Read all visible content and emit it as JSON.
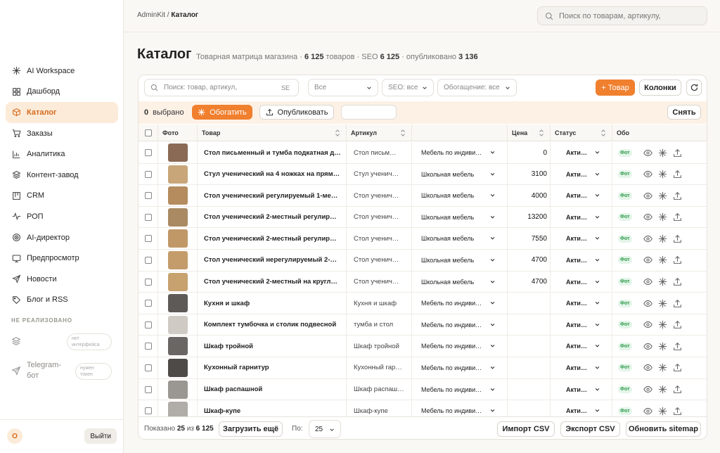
{
  "breadcrumb": {
    "root": "AdminKit",
    "sep": "/",
    "current": "Каталог"
  },
  "top_search": {
    "placeholder": "Поиск по товарам, артикулу,"
  },
  "page": {
    "title": "Каталог",
    "subtitle_prefix": "Товарная матрица магазина · ",
    "goods_count": "6 125",
    "goods_word": " товаров · SEO ",
    "seo_count": "6 125",
    "published_word": " · опубликовано ",
    "published_count": "3 136"
  },
  "sidebar": {
    "items": [
      {
        "label": "AI Workspace",
        "icon": "sparkle-icon"
      },
      {
        "label": "Дашборд",
        "icon": "grid-icon"
      },
      {
        "label": "Каталог",
        "icon": "box-icon"
      },
      {
        "label": "Заказы",
        "icon": "cart-icon"
      },
      {
        "label": "Аналитика",
        "icon": "chart-icon"
      },
      {
        "label": "Контент-завод",
        "icon": "layers-icon"
      },
      {
        "label": "CRM",
        "icon": "kanban-icon"
      },
      {
        "label": "РОП",
        "icon": "pulse-icon"
      },
      {
        "label": "AI-директор",
        "icon": "target-icon"
      },
      {
        "label": "Предпросмотр",
        "icon": "monitor-icon"
      },
      {
        "label": "Новости",
        "icon": "send-icon"
      },
      {
        "label": "Блог и RSS",
        "icon": "tag-icon"
      }
    ],
    "active_index": 2,
    "not_implemented_title": "НЕ РЕАЛИЗОВАНО",
    "not_implemented": [
      {
        "label": "",
        "badge": "нет интерфейса"
      },
      {
        "label": "Telegram-бот",
        "badge": "нужен токен"
      }
    ],
    "avatar_letter": "O",
    "logout_label": "Выйти"
  },
  "filters": {
    "search_placeholder": "Поиск: товар, артикул,",
    "search_suffix": "SE",
    "category_select": "Все",
    "seo_select": "SEO: все",
    "enrich_select": "Обогащение: все",
    "add_product": "+ Товар",
    "columns": "Колонки"
  },
  "selection": {
    "count": "0",
    "label": "выбрано",
    "enrich_button": "Обогатить",
    "publish_button": "Опубликовать",
    "clear_button": "Снять"
  },
  "table": {
    "headers": {
      "photo": "Фото",
      "name": "Товар",
      "article": "Артикул",
      "price": "Цена",
      "status": "Статус",
      "enrich": "Обо"
    },
    "rows": [
      {
        "name": "Стол письменный и тумба подкатная д…",
        "article": "Стол письм…",
        "category": "Мебель по индиви…",
        "price": "0",
        "status": "Акти…",
        "badge": "Фот"
      },
      {
        "name": "Стул ученический на 4 ножках на прям…",
        "article": "Стул ученич…",
        "category": "Школьная мебель",
        "price": "3100",
        "status": "Акти…",
        "badge": "Фот"
      },
      {
        "name": "Стол ученический регулируемый 1-ме…",
        "article": "Стол ученич…",
        "category": "Школьная мебель",
        "price": "4000",
        "status": "Акти…",
        "badge": "Фот"
      },
      {
        "name": "Стол ученический 2-местный регулир…",
        "article": "Стол ученич…",
        "category": "Школьная мебель",
        "price": "13200",
        "status": "Акти…",
        "badge": "Фот"
      },
      {
        "name": "Стол ученический 2-местный регулир…",
        "article": "Стол ученич…",
        "category": "Школьная мебель",
        "price": "7550",
        "status": "Акти…",
        "badge": "Фот"
      },
      {
        "name": "Стол ученический нерегулируемый 2-…",
        "article": "Стол ученич…",
        "category": "Школьная мебель",
        "price": "4700",
        "status": "Акти…",
        "badge": "Фот"
      },
      {
        "name": "Стол ученический 2-местный на кругл…",
        "article": "Стол ученич…",
        "category": "Школьная мебель",
        "price": "4700",
        "status": "Акти…",
        "badge": "Фот"
      },
      {
        "name": "Кухня и шкаф",
        "article": "Кухня и шкаф",
        "category": "Мебель по индиви…",
        "price": "",
        "status": "Акти…",
        "badge": "Фот"
      },
      {
        "name": "Комплект тумбочка и столик подвесной",
        "article": "тумба и стол",
        "category": "Мебель по индиви…",
        "price": "",
        "status": "Акти…",
        "badge": "Фот"
      },
      {
        "name": "Шкаф тройной",
        "article": "Шкаф тройной",
        "category": "Мебель по индиви…",
        "price": "",
        "status": "Акти…",
        "badge": "Фот"
      },
      {
        "name": "Кухонный гарнитур",
        "article": "Кухонный гар…",
        "category": "Мебель по индиви…",
        "price": "",
        "status": "Акти…",
        "badge": "Фот"
      },
      {
        "name": "Шкаф распашной",
        "article": "Шкаф распаш…",
        "category": "Мебель по индиви…",
        "price": "",
        "status": "Акти…",
        "badge": "Фот"
      },
      {
        "name": "Шкаф-купе",
        "article": "Шкаф-купе",
        "category": "Мебель по индиви…",
        "price": "",
        "status": "Акти…",
        "badge": "Фот"
      }
    ]
  },
  "footer": {
    "shown_label": "Показано",
    "shown_count": "25",
    "of_label": "из",
    "total": "6 125",
    "load_more": "Загрузить ещё",
    "per_page_label": "По:",
    "per_page_value": "25",
    "import_csv": "Импорт CSV",
    "export_csv": "Экспорт CSV",
    "update_sitemap": "Обновить sitemap"
  },
  "colors": {
    "accent": "#f07f2e",
    "active_bg": "#fcebd9",
    "success": "#2f9a4c"
  }
}
